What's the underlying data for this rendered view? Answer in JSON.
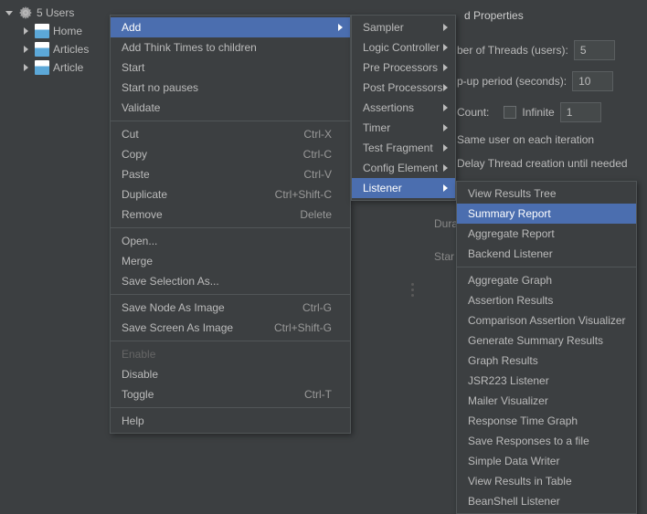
{
  "tree": {
    "root": "5 Users",
    "children": [
      "Home",
      "Articles",
      "Article"
    ]
  },
  "props": {
    "title": "d Properties",
    "threads_frag": "ber of Threads (users):",
    "threads_val": "5",
    "ramp_frag": "p-up period (seconds):",
    "ramp_val": "10",
    "count_frag": " Count:",
    "infinite": "Infinite",
    "infinite_val": "1",
    "same_user": "Same user on each iteration",
    "delay": "Delay Thread creation until needed",
    "dura_frag": "Dura",
    "star_frag": "Star"
  },
  "menu1": {
    "add": "Add",
    "att": "Add Think Times to children",
    "start": "Start",
    "startnp": "Start no pauses",
    "validate": "Validate",
    "cut": "Cut",
    "cut_k": "Ctrl-X",
    "copy": "Copy",
    "copy_k": "Ctrl-C",
    "paste": "Paste",
    "paste_k": "Ctrl-V",
    "dup": "Duplicate",
    "dup_k": "Ctrl+Shift-C",
    "remove": "Remove",
    "remove_k": "Delete",
    "open": "Open...",
    "merge": "Merge",
    "savesel": "Save Selection As...",
    "savenode": "Save Node As Image",
    "savenode_k": "Ctrl-G",
    "savescrn": "Save Screen As Image",
    "savescrn_k": "Ctrl+Shift-G",
    "enable": "Enable",
    "disable": "Disable",
    "toggle": "Toggle",
    "toggle_k": "Ctrl-T",
    "help": "Help"
  },
  "menu2": {
    "sampler": "Sampler",
    "logic": "Logic Controller",
    "pre": "Pre Processors",
    "post": "Post Processors",
    "asserts": "Assertions",
    "timer": "Timer",
    "frag": "Test Fragment",
    "config": "Config Element",
    "listener": "Listener"
  },
  "menu3": {
    "i0": "View Results Tree",
    "i1": "Summary Report",
    "i2": "Aggregate Report",
    "i3": "Backend Listener",
    "i4": "Aggregate Graph",
    "i5": "Assertion Results",
    "i6": "Comparison Assertion Visualizer",
    "i7": "Generate Summary Results",
    "i8": "Graph Results",
    "i9": "JSR223 Listener",
    "i10": "Mailer Visualizer",
    "i11": "Response Time Graph",
    "i12": "Save Responses to a file",
    "i13": "Simple Data Writer",
    "i14": "View Results in Table",
    "i15": "BeanShell Listener"
  }
}
